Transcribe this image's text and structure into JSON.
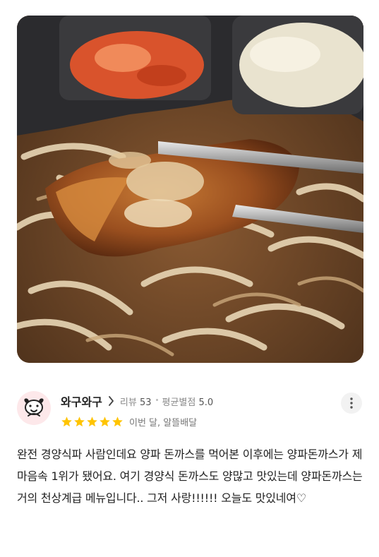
{
  "photo": {
    "alt": ""
  },
  "reviewer": {
    "nickname": "와구와구",
    "review_count_label": "리뷰",
    "review_count": "53",
    "avg_rating_label": "평균별점",
    "avg_rating": "5.0"
  },
  "review": {
    "rating": 5,
    "star_color": "#FFC400",
    "order_info": "이번 달, 알뜰배달",
    "text": "완전 경양식파 사람인데요 양파 돈까스를 먹어본 이후에는 양파돈까스가 제 마음속 1위가 됐어요. 여기 경양식 돈까스도 양많고 맛있는데 양파돈까스는 거의 천상계급 메뉴입니다.. 그저 사랑!!!!!! 오늘도 맛있네여♡"
  },
  "icons": {
    "avatar": "dog-face-icon",
    "chevron": "chevron-right-icon",
    "more": "more-vertical-icon",
    "star": "star-icon"
  }
}
